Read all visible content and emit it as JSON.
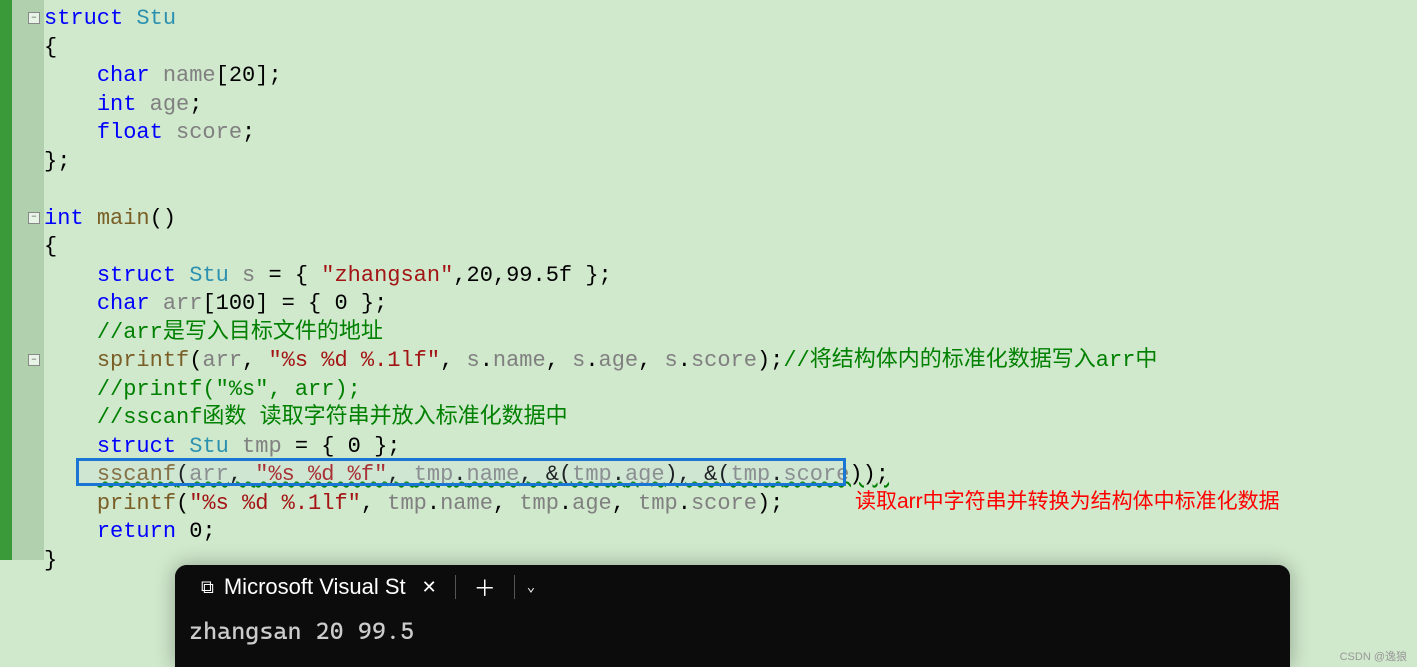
{
  "code": {
    "lines": [
      {
        "indent": 0,
        "parts": [
          {
            "t": "keyword",
            "v": "struct"
          },
          {
            "t": "punc",
            "v": " "
          },
          {
            "t": "type",
            "v": "Stu"
          }
        ]
      },
      {
        "indent": 0,
        "parts": [
          {
            "t": "punc",
            "v": "{"
          }
        ]
      },
      {
        "indent": 1,
        "parts": [
          {
            "t": "keyword",
            "v": "char"
          },
          {
            "t": "punc",
            "v": " "
          },
          {
            "t": "ident",
            "v": "name"
          },
          {
            "t": "punc",
            "v": "[20];"
          }
        ]
      },
      {
        "indent": 1,
        "parts": [
          {
            "t": "keyword",
            "v": "int"
          },
          {
            "t": "punc",
            "v": " "
          },
          {
            "t": "ident",
            "v": "age"
          },
          {
            "t": "punc",
            "v": ";"
          }
        ]
      },
      {
        "indent": 1,
        "parts": [
          {
            "t": "keyword",
            "v": "float"
          },
          {
            "t": "punc",
            "v": " "
          },
          {
            "t": "ident",
            "v": "score"
          },
          {
            "t": "punc",
            "v": ";"
          }
        ]
      },
      {
        "indent": 0,
        "parts": [
          {
            "t": "punc",
            "v": "};"
          }
        ]
      },
      {
        "indent": 0,
        "parts": []
      },
      {
        "indent": 0,
        "parts": [
          {
            "t": "keyword",
            "v": "int"
          },
          {
            "t": "punc",
            "v": " "
          },
          {
            "t": "func",
            "v": "main"
          },
          {
            "t": "punc",
            "v": "()"
          }
        ]
      },
      {
        "indent": 0,
        "parts": [
          {
            "t": "punc",
            "v": "{"
          }
        ]
      },
      {
        "indent": 1,
        "parts": [
          {
            "t": "keyword",
            "v": "struct"
          },
          {
            "t": "punc",
            "v": " "
          },
          {
            "t": "type",
            "v": "Stu"
          },
          {
            "t": "punc",
            "v": " "
          },
          {
            "t": "ident",
            "v": "s"
          },
          {
            "t": "punc",
            "v": " = { "
          },
          {
            "t": "string",
            "v": "\"zhangsan\""
          },
          {
            "t": "punc",
            "v": ",20,99.5f };"
          }
        ]
      },
      {
        "indent": 1,
        "parts": [
          {
            "t": "keyword",
            "v": "char"
          },
          {
            "t": "punc",
            "v": " "
          },
          {
            "t": "ident",
            "v": "arr"
          },
          {
            "t": "punc",
            "v": "[100] = { 0 };"
          }
        ]
      },
      {
        "indent": 1,
        "parts": [
          {
            "t": "comment",
            "v": "//arr是写入目标文件的地址"
          }
        ]
      },
      {
        "indent": 1,
        "parts": [
          {
            "t": "func",
            "v": "sprintf"
          },
          {
            "t": "punc",
            "v": "("
          },
          {
            "t": "ident",
            "v": "arr"
          },
          {
            "t": "punc",
            "v": ", "
          },
          {
            "t": "string",
            "v": "\"%s %d %.1lf\""
          },
          {
            "t": "punc",
            "v": ", "
          },
          {
            "t": "ident",
            "v": "s"
          },
          {
            "t": "punc",
            "v": "."
          },
          {
            "t": "ident",
            "v": "name"
          },
          {
            "t": "punc",
            "v": ", "
          },
          {
            "t": "ident",
            "v": "s"
          },
          {
            "t": "punc",
            "v": "."
          },
          {
            "t": "ident",
            "v": "age"
          },
          {
            "t": "punc",
            "v": ", "
          },
          {
            "t": "ident",
            "v": "s"
          },
          {
            "t": "punc",
            "v": "."
          },
          {
            "t": "ident",
            "v": "score"
          },
          {
            "t": "punc",
            "v": ");"
          },
          {
            "t": "comment",
            "v": "//将结构体内的标准化数据写入arr中"
          }
        ]
      },
      {
        "indent": 1,
        "parts": [
          {
            "t": "comment",
            "v": "//printf(\"%s\", arr);"
          }
        ]
      },
      {
        "indent": 1,
        "parts": [
          {
            "t": "comment",
            "v": "//sscanf函数 读取字符串并放入标准化数据中"
          }
        ]
      },
      {
        "indent": 1,
        "parts": [
          {
            "t": "keyword",
            "v": "struct"
          },
          {
            "t": "punc",
            "v": " "
          },
          {
            "t": "type",
            "v": "Stu"
          },
          {
            "t": "punc",
            "v": " "
          },
          {
            "t": "ident",
            "v": "tmp"
          },
          {
            "t": "punc",
            "v": " = { 0 };"
          }
        ]
      },
      {
        "indent": 1,
        "parts": [
          {
            "t": "func",
            "v": "sscanf",
            "sq": true
          },
          {
            "t": "punc",
            "v": "(",
            "sq": true
          },
          {
            "t": "ident",
            "v": "arr",
            "sq": true
          },
          {
            "t": "punc",
            "v": ", ",
            "sq": true
          },
          {
            "t": "string",
            "v": "\"%s %d %f\"",
            "sq": true
          },
          {
            "t": "punc",
            "v": ", ",
            "sq": true
          },
          {
            "t": "ident",
            "v": "tmp",
            "sq": true
          },
          {
            "t": "punc",
            "v": ".",
            "sq": true
          },
          {
            "t": "ident",
            "v": "name",
            "sq": true
          },
          {
            "t": "punc",
            "v": ", &(",
            "sq": true
          },
          {
            "t": "ident",
            "v": "tmp",
            "sq": true
          },
          {
            "t": "punc",
            "v": ".",
            "sq": true
          },
          {
            "t": "ident",
            "v": "age",
            "sq": true
          },
          {
            "t": "punc",
            "v": "), &(",
            "sq": true
          },
          {
            "t": "ident",
            "v": "tmp",
            "sq": true
          },
          {
            "t": "punc",
            "v": ".",
            "sq": true
          },
          {
            "t": "ident",
            "v": "score",
            "sq": true
          },
          {
            "t": "punc",
            "v": "));",
            "sq": true
          }
        ]
      },
      {
        "indent": 1,
        "parts": [
          {
            "t": "func",
            "v": "printf"
          },
          {
            "t": "punc",
            "v": "("
          },
          {
            "t": "string",
            "v": "\"%s %d %.1lf\""
          },
          {
            "t": "punc",
            "v": ", "
          },
          {
            "t": "ident",
            "v": "tmp"
          },
          {
            "t": "punc",
            "v": "."
          },
          {
            "t": "ident",
            "v": "name"
          },
          {
            "t": "punc",
            "v": ", "
          },
          {
            "t": "ident",
            "v": "tmp"
          },
          {
            "t": "punc",
            "v": "."
          },
          {
            "t": "ident",
            "v": "age"
          },
          {
            "t": "punc",
            "v": ", "
          },
          {
            "t": "ident",
            "v": "tmp"
          },
          {
            "t": "punc",
            "v": "."
          },
          {
            "t": "ident",
            "v": "score"
          },
          {
            "t": "punc",
            "v": ");"
          }
        ]
      },
      {
        "indent": 1,
        "parts": [
          {
            "t": "keyword",
            "v": "return"
          },
          {
            "t": "punc",
            "v": " 0;"
          }
        ]
      },
      {
        "indent": 0,
        "parts": [
          {
            "t": "punc",
            "v": "}"
          }
        ]
      }
    ]
  },
  "fold_positions": [
    0,
    7,
    12
  ],
  "annotation": "读取arr中字符串并转换为结构体中标准化数据",
  "terminal": {
    "tab_title": "Microsoft Visual St",
    "output": "zhangsan 20 99.5"
  },
  "watermark": "CSDN @逸狼"
}
